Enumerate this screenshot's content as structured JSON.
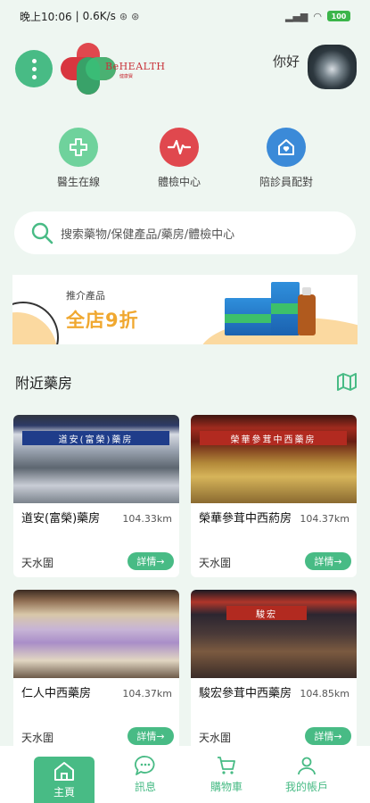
{
  "status_bar": {
    "time": "晚上10:06",
    "network_speed": "0.6K/s",
    "battery": "100"
  },
  "header": {
    "logo_text": "BeHEALTH",
    "logo_sub": "健康寶",
    "greeting": "你好"
  },
  "services": [
    {
      "label": "醫生在線",
      "icon": "medical-cross-icon",
      "color": "#48bb85"
    },
    {
      "label": "體檢中心",
      "icon": "heartbeat-icon",
      "color": "#e0484e"
    },
    {
      "label": "陪診員配對",
      "icon": "home-heart-icon",
      "color": "#3b8ad8"
    }
  ],
  "search": {
    "placeholder": "搜索藥物/保健產品/藥房/體檢中心"
  },
  "banner": {
    "subtitle": "推介產品",
    "title": "全店9折"
  },
  "nearby": {
    "title": "附近藥房"
  },
  "pharmacies": [
    {
      "name": "道安(富榮)藥房",
      "distance": "104.33km",
      "district": "天水圍",
      "detail": "詳情→",
      "sign": "道安(富榮)藥房"
    },
    {
      "name": "榮華參茸中西葯房",
      "distance": "104.37km",
      "district": "天水圍",
      "detail": "詳情→",
      "sign": "榮華參茸中西藥房"
    },
    {
      "name": "仁人中西藥房",
      "distance": "104.37km",
      "district": "天水圍",
      "detail": "詳情→",
      "sign": ""
    },
    {
      "name": "駿宏參茸中西藥房",
      "distance": "104.85km",
      "district": "天水圍",
      "detail": "詳情→",
      "sign": "駿宏"
    }
  ],
  "bottom_nav": [
    {
      "label": "主頁",
      "icon": "home-icon",
      "active": true
    },
    {
      "label": "訊息",
      "icon": "chat-bubble-icon",
      "active": false
    },
    {
      "label": "購物車",
      "icon": "cart-icon",
      "active": false
    },
    {
      "label": "我的帳戶",
      "icon": "user-icon",
      "active": false
    }
  ],
  "colors": {
    "primary": "#48bb85",
    "background": "#eef6f1",
    "banner_accent": "#f0a830"
  }
}
